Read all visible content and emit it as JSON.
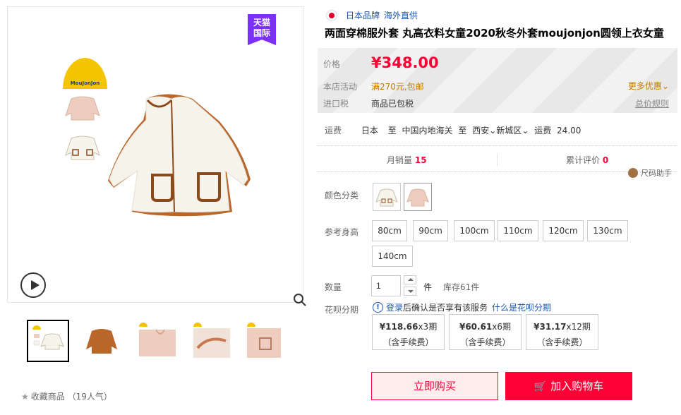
{
  "gallery": {
    "badge_line1": "天猫",
    "badge_line2": "国际",
    "brand_logo_text": "MouJonJon",
    "favorite_label": "收藏商品",
    "favorite_count": "（19人气）"
  },
  "product": {
    "origin_country": "日本品牌",
    "origin_tag": "海外直供",
    "title": "两面穿棉服外套 丸高衣料女童2020秋冬外套moujonjon圆领上衣女童"
  },
  "price_box": {
    "price_label": "价格",
    "price": "¥348.00",
    "promo_label": "本店活动",
    "promo_text": "满270元,包邮",
    "more_promo": "更多优惠",
    "tax_label": "进口税",
    "tax_text": "商品已包税",
    "tax_rule": "总价规则"
  },
  "shipping": {
    "label": "运费",
    "from": "日本",
    "to_prefix": "至",
    "via": "中国内地海关",
    "dest_prefix": "至",
    "city": "西安",
    "district": "新城区",
    "fee_label": "运费",
    "fee": "24.00"
  },
  "stats": {
    "monthly_label": "月销量",
    "monthly_value": "15",
    "review_label": "累计评价",
    "review_value": "0",
    "size_helper": "尺码助手"
  },
  "options": {
    "color_label": "颜色分类",
    "height_label": "参考身高",
    "sizes": [
      "80cm",
      "90cm",
      "100cm",
      "110cm",
      "120cm",
      "130cm",
      "140cm"
    ]
  },
  "quantity": {
    "label": "数量",
    "value": "1",
    "unit": "件",
    "stock": "库存61件"
  },
  "huabei": {
    "label": "花呗分期",
    "login": "登录",
    "note": "后确认是否享有该服务",
    "what_is": "什么是花呗分期",
    "plans": [
      {
        "amount": "¥118.66",
        "period": "x3期",
        "fee": "（含手续费）"
      },
      {
        "amount": "¥60.61",
        "period": "x6期",
        "fee": "（含手续费）"
      },
      {
        "amount": "¥31.17",
        "period": "x12期",
        "fee": "（含手续费）"
      }
    ]
  },
  "actions": {
    "buy_now": "立即购买",
    "add_cart": "加入购物车"
  },
  "colors": {
    "accent": "#ff0036",
    "tmall_purple": "#7b2ff7",
    "promo_orange": "#c57a00",
    "link_blue": "#1a56b0"
  }
}
